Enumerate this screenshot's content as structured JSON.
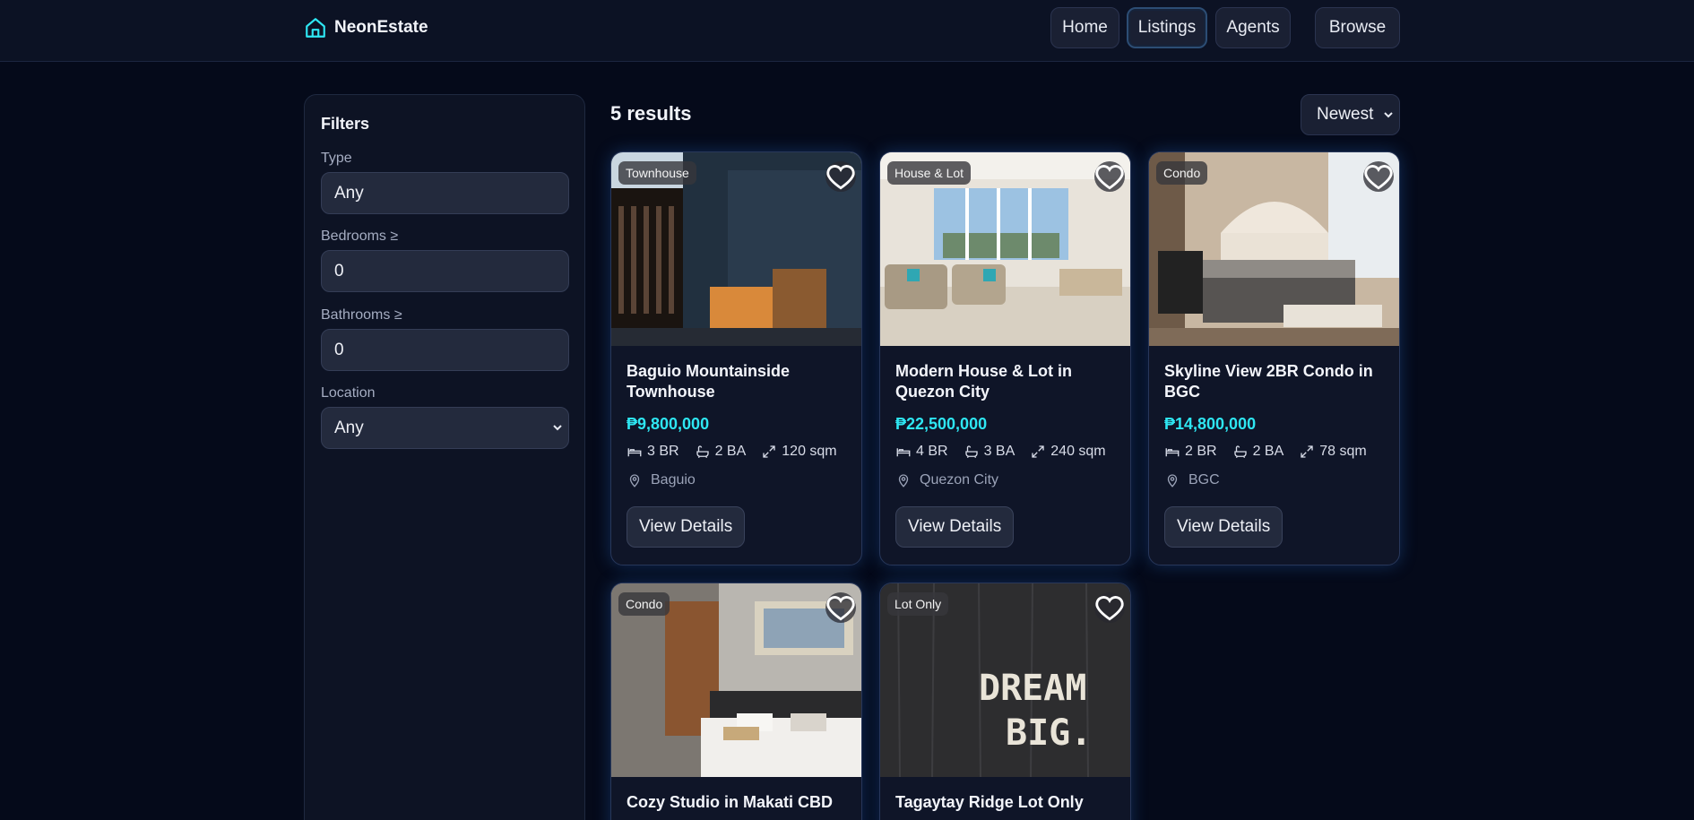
{
  "app": {
    "brand_name": "NeonEstate",
    "accent_color": "#2ee6f2"
  },
  "nav": {
    "items": [
      {
        "label": "Home"
      },
      {
        "label": "Listings"
      },
      {
        "label": "Agents"
      },
      {
        "label": "Browse"
      }
    ],
    "active": "Listings"
  },
  "filters": {
    "title": "Filters",
    "type": {
      "label": "Type",
      "value": "Any"
    },
    "bedrooms": {
      "label": "Bedrooms ≥",
      "value": "0"
    },
    "bathrooms": {
      "label": "Bathrooms ≥",
      "value": "0"
    },
    "location": {
      "label": "Location",
      "value": "Any"
    }
  },
  "results": {
    "count_label": "5 results",
    "sort_value": "Newest"
  },
  "listings": [
    {
      "badge": "Townhouse",
      "title": "Baguio Mountainside Townhouse",
      "price": "₱9,800,000",
      "beds": "3 BR",
      "baths": "2 BA",
      "area": "120 sqm",
      "location": "Baguio",
      "button": "View Details",
      "photo": "townhouse-facade-night"
    },
    {
      "badge": "House & Lot",
      "title": "Modern House & Lot in Quezon City",
      "price": "₱22,500,000",
      "beds": "4 BR",
      "baths": "3 BA",
      "area": "240 sqm",
      "location": "Quezon City",
      "button": "View Details",
      "photo": "bright-living-room"
    },
    {
      "badge": "Condo",
      "title": "Skyline View 2BR Condo in BGC",
      "price": "₱14,800,000",
      "beds": "2 BR",
      "baths": "2 BA",
      "area": "78 sqm",
      "location": "BGC",
      "button": "View Details",
      "photo": "bedroom-tufted-headboard"
    },
    {
      "badge": "Condo",
      "title": "Cozy Studio in Makati CBD",
      "photo": "studio-bedroom"
    },
    {
      "badge": "Lot Only",
      "title": "Tagaytay Ridge Lot Only",
      "photo": "chalk-dream-big",
      "photo_text_1": "DREAM",
      "photo_text_2": "BIG."
    }
  ]
}
